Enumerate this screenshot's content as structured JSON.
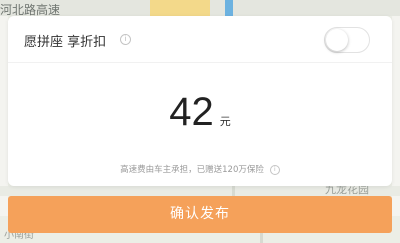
{
  "map": {
    "road_label": "河北路高速",
    "garden_label": "九龙花园",
    "bottom_left_label": "小南街"
  },
  "carpool": {
    "label": "愿拼座 享折扣",
    "info_icon": "info-circle-icon",
    "toggle_on": false
  },
  "price": {
    "amount": "42",
    "unit": "元"
  },
  "notice": {
    "text": "高速费由车主承担，已赠送120万保险",
    "icon": "info-circle-icon"
  },
  "confirm_button": {
    "label": "确认发布",
    "color": "#f5a15a"
  }
}
